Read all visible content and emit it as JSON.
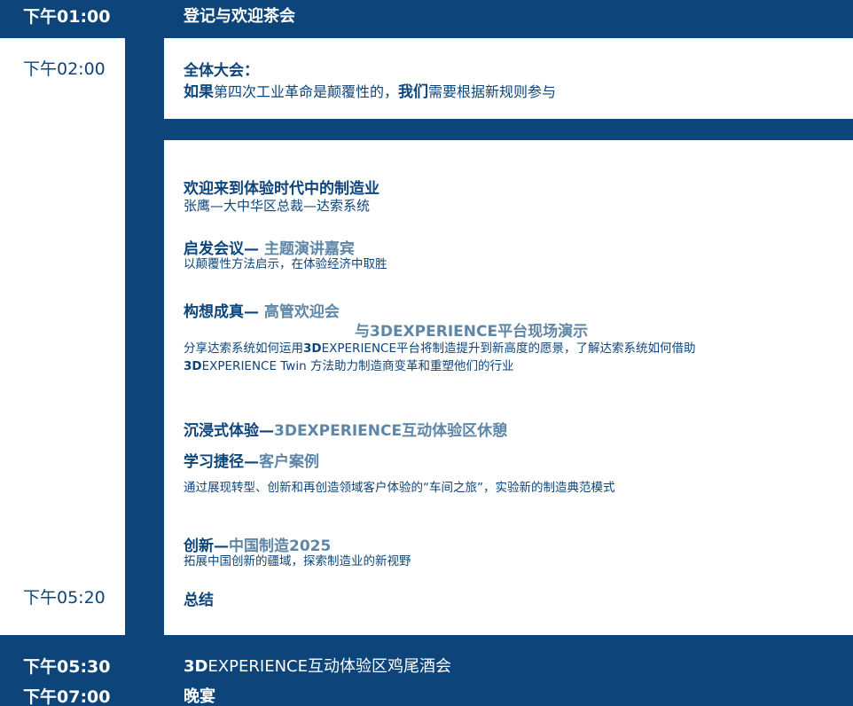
{
  "rows": {
    "r0100": {
      "time": "下午01:00",
      "title": "登记与欢迎茶会"
    },
    "r0200": {
      "time": "下午02:00"
    },
    "r0520": {
      "time": "下午05:20"
    },
    "r0530": {
      "time": "下午05:30",
      "title_3d": "3D",
      "title_rest": "EXPERIENCE互动体验区鸡尾酒会"
    },
    "r0700": {
      "time": "下午07:00",
      "title": "晚宴"
    }
  },
  "plenary": {
    "heading": "全体大会：",
    "line_bold1": "如果",
    "line_norm1": "第四次工业革命是颠覆性的，",
    "line_bold2": "我们",
    "line_norm2": "需要根据新规则参与"
  },
  "sessions": {
    "welcome": {
      "title": "欢迎来到体验时代中的制造业",
      "speaker": "张鹰—大中华区总裁—达索系统"
    },
    "inspire": {
      "title_dark": "启发会议— ",
      "title_gray": "主题演讲嘉宾",
      "desc": "以颠覆性方法启示，在体验经济中取胜"
    },
    "vision": {
      "title_dark": "构想成真— ",
      "title_gray": "高管欢迎会",
      "title_gray2": "与3DEXPERIENCE平台现场演示",
      "desc1_a": "分享达索系统如何运用",
      "desc1_3d": "3D",
      "desc1_b": "EXPERIENCE平台将制造提升到新高度的愿景，了解达索系统如何借助",
      "desc2_3d": "3D",
      "desc2_b": "EXPERIENCE Twin 方法助力制造商变革和重塑他们的行业"
    },
    "immersive": {
      "title_dark": "沉浸式体验—",
      "title_gray": "3DEXPERIENCE互动体验区休憩"
    },
    "learning": {
      "title_dark": "学习捷径—",
      "title_gray": "客户案例",
      "desc": "通过展现转型、创新和再创造领域客户体验的“车间之旅”，实验新的制造典范模式"
    },
    "innovation": {
      "title_dark": "创新—",
      "title_gray": "中国制造2025",
      "desc": "拓展中国创新的疆域，探索制造业的新视野"
    },
    "summary": {
      "title": "总结"
    }
  },
  "colors": {
    "navy": "#0d4479",
    "gray_blue": "#5e86a6",
    "white": "#ffffff"
  }
}
